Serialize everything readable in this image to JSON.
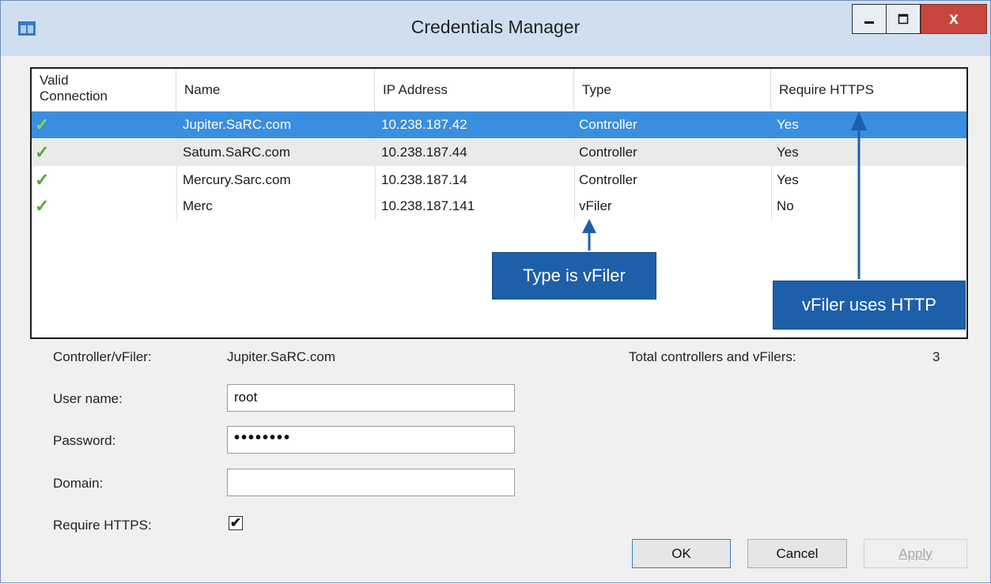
{
  "window": {
    "title": "Credentials Manager",
    "close_glyph": "x"
  },
  "table": {
    "columns": [
      "Valid Connection",
      "Name",
      "IP Address",
      "Type",
      "Require HTTPS"
    ],
    "col_valid_line1": "Valid",
    "col_valid_line2": "Connection",
    "rows": [
      {
        "valid": "✓",
        "name": "Jupiter.SaRC.com",
        "ip": "10.238.187.42",
        "type": "Controller",
        "https": "Yes",
        "selected": true
      },
      {
        "valid": "✓",
        "name": "Satum.SaRC.com",
        "ip": "10.238.187.44",
        "type": "Controller",
        "https": "Yes"
      },
      {
        "valid": "✓",
        "name": "Mercury.Sarc.com",
        "ip": "10.238.187.14",
        "type": "Controller",
        "https": "Yes"
      },
      {
        "valid": "✓",
        "name": "Merc",
        "ip": "10.238.187.141",
        "type": "vFiler",
        "https": "No"
      }
    ]
  },
  "callouts": {
    "type_note": "Type is vFiler",
    "https_note": "vFiler uses HTTP"
  },
  "details": {
    "controller_label": "Controller/vFiler:",
    "controller_value": "Jupiter.SaRC.com",
    "total_label": "Total controllers and vFilers:",
    "total_value": "3"
  },
  "form": {
    "username_label": "User name:",
    "username_value": "root",
    "password_label": "Password:",
    "password_value": "••••••••",
    "domain_label": "Domain:",
    "domain_value": "",
    "https_label": "Require HTTPS:",
    "https_checked": "✔"
  },
  "buttons": {
    "ok": "OK",
    "cancel": "Cancel",
    "apply": "Apply"
  },
  "colors": {
    "selection": "#3a8ee0",
    "callout": "#1e5faa",
    "check": "#4caa2b",
    "close_button": "#c7473e"
  },
  "icons": [
    "app-window-icon",
    "minimize-icon",
    "maximize-icon",
    "close-icon",
    "checkmark-icon",
    "arrow-up-icon"
  ]
}
